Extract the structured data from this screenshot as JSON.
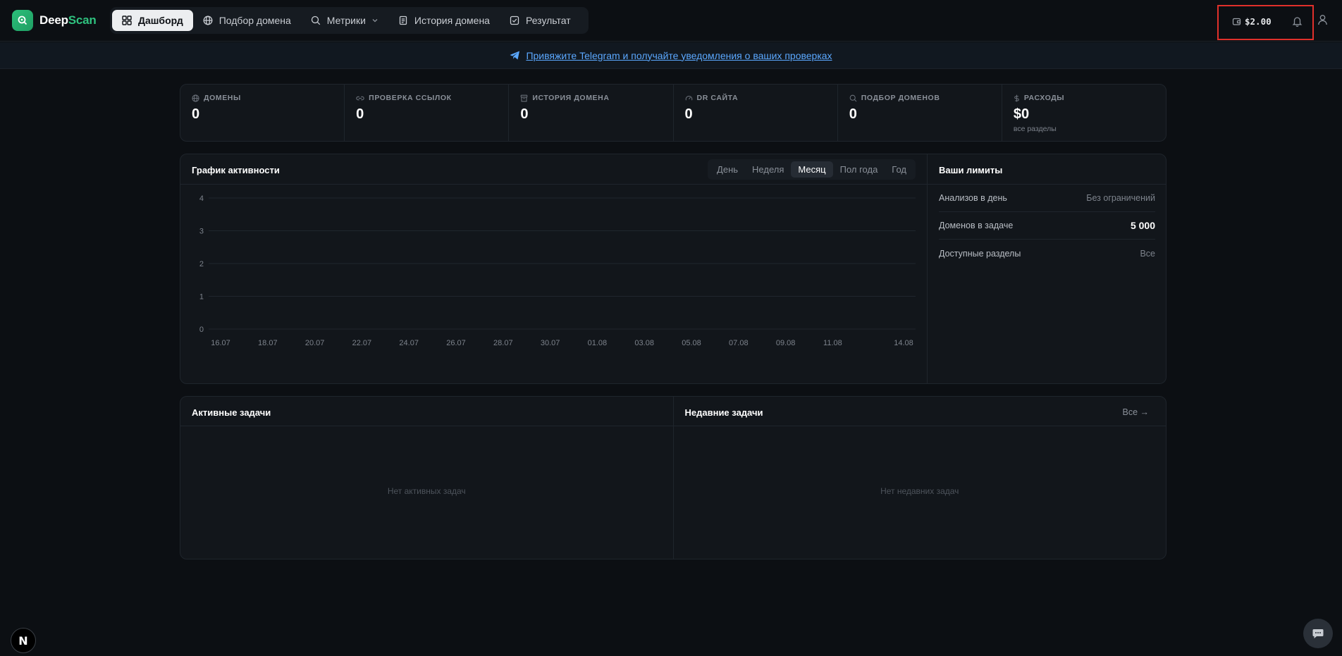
{
  "brand": {
    "name_part1": "Deep",
    "name_part2": "Scan"
  },
  "nav": {
    "items": [
      {
        "label": "Дашборд",
        "icon": "grid-icon",
        "active": true
      },
      {
        "label": "Подбор домена",
        "icon": "globe-icon",
        "active": false
      },
      {
        "label": "Метрики",
        "icon": "search-icon",
        "active": false,
        "dropdown": true
      },
      {
        "label": "История домена",
        "icon": "document-icon",
        "active": false
      },
      {
        "label": "Результат",
        "icon": "check-square-icon",
        "active": false
      }
    ]
  },
  "header": {
    "balance": "$2.00"
  },
  "banner": {
    "text": "Привяжите Telegram и получайте уведомления о ваших проверках"
  },
  "stats": [
    {
      "label": "ДОМЕНЫ",
      "value": "0",
      "icon": "globe-icon"
    },
    {
      "label": "ПРОВЕРКА ССЫЛОК",
      "value": "0",
      "icon": "link-icon"
    },
    {
      "label": "ИСТОРИЯ ДОМЕНА",
      "value": "0",
      "icon": "archive-icon"
    },
    {
      "label": "DR САЙТА",
      "value": "0",
      "icon": "gauge-icon"
    },
    {
      "label": "ПОДБОР ДОМЕНОВ",
      "value": "0",
      "icon": "search-icon"
    },
    {
      "label": "РАСХОДЫ",
      "value": "$0",
      "sub": "все разделы",
      "icon": "dollar-icon"
    }
  ],
  "activity": {
    "title": "График активности",
    "periods": [
      "День",
      "Неделя",
      "Месяц",
      "Пол года",
      "Год"
    ],
    "active_period": "Месяц"
  },
  "chart_data": {
    "type": "line",
    "title": "График активности",
    "xlabel": "",
    "ylabel": "",
    "y_ticks": [
      0,
      1,
      2,
      3,
      4
    ],
    "ylim": [
      0,
      4
    ],
    "x_ticks": [
      "16.07",
      "18.07",
      "20.07",
      "22.07",
      "24.07",
      "26.07",
      "28.07",
      "30.07",
      "01.08",
      "03.08",
      "05.08",
      "07.08",
      "09.08",
      "11.08",
      "14.08"
    ],
    "grid": true,
    "series": []
  },
  "limits": {
    "title": "Ваши лимиты",
    "rows": [
      {
        "key": "Анализов в день",
        "value": "Без ограничений"
      },
      {
        "key": "Доменов в задаче",
        "value": "5 000"
      },
      {
        "key": "Доступные разделы",
        "value": "Все"
      }
    ]
  },
  "tasks": {
    "active": {
      "title": "Активные задачи",
      "empty": "Нет активных задач"
    },
    "recent": {
      "title": "Недавние задачи",
      "all_label": "Все →",
      "empty": "Нет недавних задач"
    }
  },
  "badges": {
    "next": "N"
  }
}
